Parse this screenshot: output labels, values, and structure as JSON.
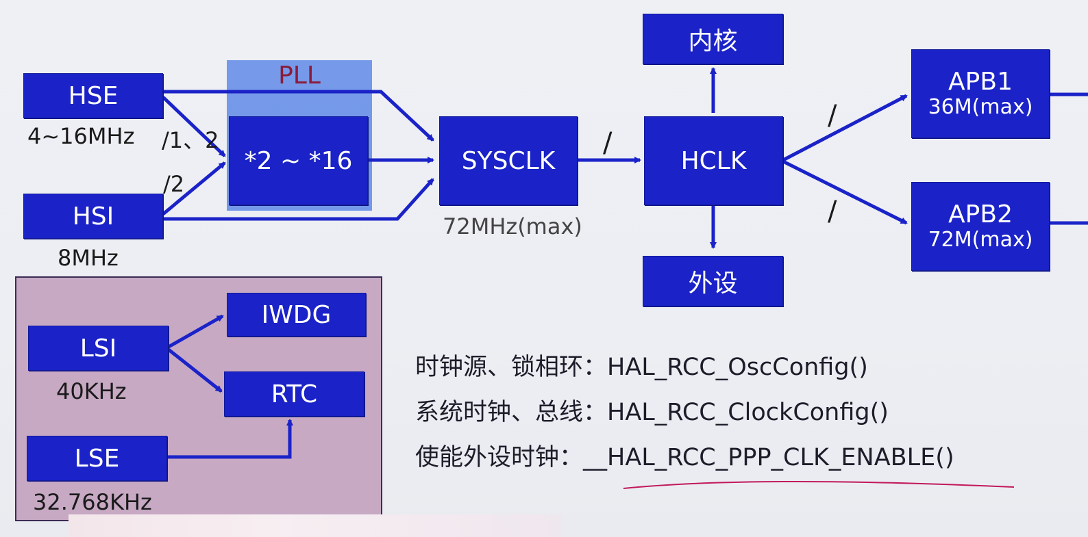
{
  "colors": {
    "box_fill": "#1a22c8",
    "arrow": "#1a22c8",
    "pll_panel": "#6f93e8",
    "pll_title": "#8a1c3a",
    "low_speed_panel": "#c7a9c4",
    "underline": "#c2185b"
  },
  "sources": {
    "hse": {
      "name": "HSE",
      "freq": "4~16MHz"
    },
    "hsi": {
      "name": "HSI",
      "freq": "8MHz"
    },
    "lsi": {
      "name": "LSI",
      "freq": "40KHz"
    },
    "lse": {
      "name": "LSE",
      "freq": "32.768KHz"
    }
  },
  "pll": {
    "title": "PLL",
    "multiplier": "*2 ~ *16",
    "hse_div": "/1、2",
    "hsi_div": "/2"
  },
  "sysclk": {
    "name": "SYSCLK",
    "freq": "72MHz(max)",
    "div": "/"
  },
  "hclk": {
    "name": "HCLK"
  },
  "core": {
    "name": "内核"
  },
  "peripheral": {
    "name": "外设"
  },
  "apb1": {
    "name": "APB1",
    "freq": "36M(max)",
    "div": "/"
  },
  "apb2": {
    "name": "APB2",
    "freq": "72M(max)",
    "div": "/"
  },
  "iwdg": {
    "name": "IWDG"
  },
  "rtc": {
    "name": "RTC"
  },
  "api_lines": [
    {
      "label": "时钟源、锁相环：",
      "func": "HAL_RCC_OscConfig()"
    },
    {
      "label": "系统时钟、总线：",
      "func": "HAL_RCC_ClockConfig()"
    },
    {
      "label": "使能外设时钟：",
      "func": "__HAL_RCC_PPP_CLK_ENABLE()"
    }
  ]
}
